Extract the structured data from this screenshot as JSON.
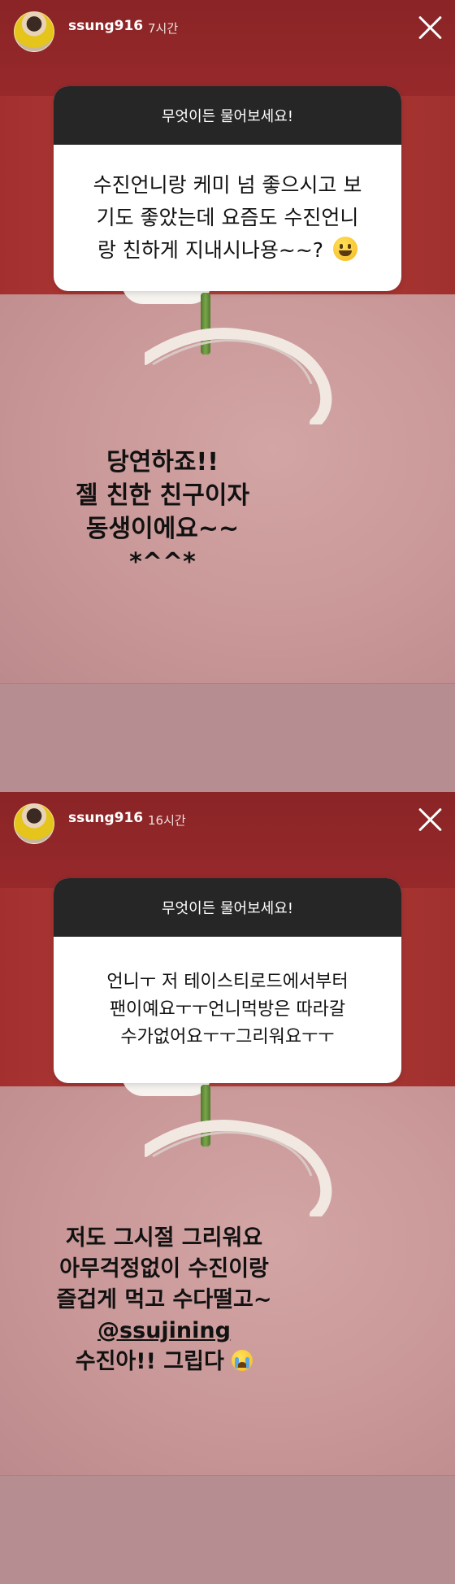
{
  "stories": [
    {
      "username": "ssung916",
      "time": "7시간",
      "prompt": "무엇이든 물어보세요!",
      "question_line1": "수진언니랑 케미 넘 좋으시고 보",
      "question_line2": "기도 좋았는데 요즘도 수진언니",
      "question_line3": "랑 친하게 지내시나용~~?",
      "answer_lines": [
        "당연하죠!!",
        "젤 친한 친구이자",
        "동생이에요~~",
        "*^^*"
      ]
    },
    {
      "username": "ssung916",
      "time": "16시간",
      "prompt": "무엇이든 물어보세요!",
      "question_line1": "언니ㅜ 저 테이스티로드에서부터",
      "question_line2": "팬이예요ㅜㅜ언니먹방은 따라갈",
      "question_line3": "수가없어요ㅜㅜ그리워요ㅜㅜ",
      "answer_lines": [
        "저도 그시절 그리워요",
        "아무걱정없이 수진이랑",
        "즐겁게 먹고 수다떨고~"
      ],
      "mention": "@ssujining",
      "answer_last": "수진아!! 그립다"
    }
  ],
  "icons": {
    "close": "close-icon",
    "emoji_grin": "grinning-face-emoji",
    "emoji_cry": "loudly-crying-face-emoji"
  },
  "colors": {
    "background_top": "#9a2a2c",
    "background_bottom": "#d3a5a5",
    "card_header": "#262626"
  }
}
